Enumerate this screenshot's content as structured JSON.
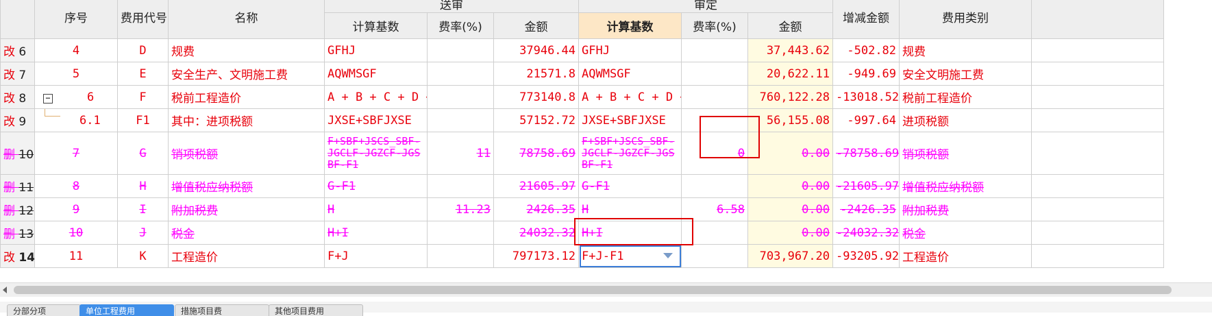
{
  "header": {
    "seq": "序号",
    "code": "费用代号",
    "name": "名称",
    "group1_title": "送审",
    "group2_title": "审定",
    "base": "计算基数",
    "rate": "费率(%)",
    "amount": "金额",
    "diff": "增减金额",
    "category": "费用类别"
  },
  "rows": [
    {
      "mark": "改",
      "no": "6",
      "seq": "4",
      "code": "D",
      "name": "规费",
      "base1": "GFHJ",
      "rate1": "",
      "amt1": "37946.44",
      "base2": "GFHJ",
      "rate2": "",
      "amt2": "37,443.62",
      "diff": "-502.82",
      "cat": "规费"
    },
    {
      "mark": "改",
      "no": "7",
      "seq": "5",
      "code": "E",
      "name": "安全生产、文明施工费",
      "base1": "AQWMSGF",
      "rate1": "",
      "amt1": "21571.8",
      "base2": "AQWMSGF",
      "rate2": "",
      "amt2": "20,622.11",
      "diff": "-949.69",
      "cat": "安全文明施工费"
    },
    {
      "mark": "改",
      "no": "8",
      "seq": "6",
      "code": "F",
      "name": "税前工程造价",
      "base1": "A + B + C + D + E",
      "rate1": "",
      "amt1": "773140.8",
      "base2": "A + B + C + D + E",
      "rate2": "",
      "amt2": "760,122.28",
      "diff": "-13018.52",
      "cat": "税前工程造价",
      "tree": "−"
    },
    {
      "mark": "改",
      "no": "9",
      "seq": "6.1",
      "code": "F1",
      "name": "其中：进项税额",
      "base1": "JXSE+SBFJXSE",
      "rate1": "",
      "amt1": "57152.72",
      "base2": "JXSE+SBFJXSE",
      "rate2": "",
      "amt2": "56,155.08",
      "diff": "-997.64",
      "cat": "进项税额"
    },
    {
      "mark": "删",
      "no": "10",
      "seq": "7",
      "code": "G",
      "name": "销项税额",
      "base1": "F+SBF+JSCS_SBF-JGCLF-JGZCF-JGSBF-F1",
      "rate1": "11",
      "amt1": "78758.69",
      "base2": "F+SBF+JSCS_SBF-JGCLF-JGZCF-JGSBF-F1",
      "rate2": "0",
      "amt2": "0.00",
      "diff": "-78758.69",
      "cat": "销项税额"
    },
    {
      "mark": "删",
      "no": "11",
      "seq": "8",
      "code": "H",
      "name": "增值税应纳税额",
      "base1": "G-F1",
      "rate1": "",
      "amt1": "21605.97",
      "base2": "G-F1",
      "rate2": "",
      "amt2": "0.00",
      "diff": "-21605.97",
      "cat": "增值税应纳税额"
    },
    {
      "mark": "删",
      "no": "12",
      "seq": "9",
      "code": "I",
      "name": "附加税费",
      "base1": "H",
      "rate1": "11.23",
      "amt1": "2426.35",
      "base2": "H",
      "rate2": "6.58",
      "amt2": "0.00",
      "diff": "-2426.35",
      "cat": "附加税费"
    },
    {
      "mark": "删",
      "no": "13",
      "seq": "10",
      "code": "J",
      "name": "税金",
      "base1": "H+I",
      "rate1": "",
      "amt1": "24032.32",
      "base2": "H+I",
      "rate2": "",
      "amt2": "0.00",
      "diff": "-24032.32",
      "cat": "税金"
    },
    {
      "mark": "改",
      "no": "14",
      "seq": "11",
      "code": "K",
      "name": "工程造价",
      "base1": "F+J",
      "rate1": "",
      "amt1": "797173.12",
      "base2": "F+J-F1",
      "rate2": "",
      "amt2": "703,967.20",
      "diff": "-93205.92",
      "cat": "工程造价"
    }
  ],
  "tabs": [
    "分部分项",
    "单位工程费用",
    "措施项目费",
    "其他项目费用"
  ]
}
